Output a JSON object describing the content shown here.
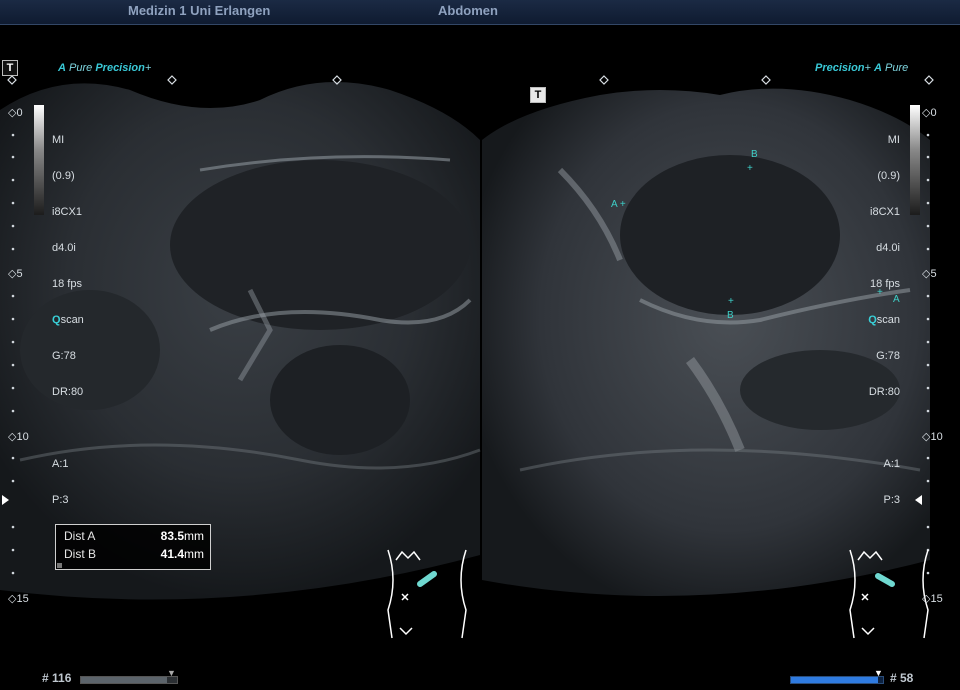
{
  "header": {
    "institution": "Medizin 1 Uni Erlangen",
    "exam": "Abdomen"
  },
  "brand": {
    "left": "Pure Precision+",
    "right": "Precision+ Pure"
  },
  "brand_parts": {
    "a": "A",
    "pure": "Pure",
    "precision": "Precision",
    "plus": "+"
  },
  "t_button": "T",
  "readout": {
    "mi": "MI",
    "mi_value": "(0.9)",
    "probe": "i8CX1",
    "depth": "d4.0i",
    "fps": "18 fps",
    "qscan_q": "Q",
    "qscan_rest": "scan",
    "gain": "G:78",
    "dr": "DR:80",
    "a": "A:1",
    "p": "P:3"
  },
  "depth_scale": {
    "d0": "0",
    "d5": "5",
    "d10": "10",
    "d15": "15"
  },
  "measurements": [
    {
      "label": "Dist A",
      "value": "83.5",
      "unit": "mm"
    },
    {
      "label": "Dist B",
      "value": "41.4",
      "unit": "mm"
    }
  ],
  "calipers": {
    "a": "A",
    "b": "B",
    "plus": "+"
  },
  "frames": {
    "left": "# 116",
    "right": "# 58"
  },
  "left_cine_fraction": 0.9,
  "right_cine_fraction": 0.95,
  "colors": {
    "accent": "#39d0d8",
    "header_text": "#8fa2bf",
    "cine_active": "#2f7be0"
  }
}
